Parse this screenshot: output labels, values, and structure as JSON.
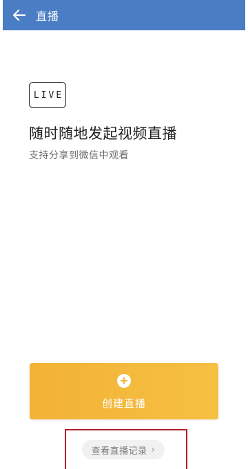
{
  "header": {
    "back_icon": "arrow-left-icon",
    "title": "直播"
  },
  "hero": {
    "badge": "LIVE",
    "headline": "随时随地发起视频直播",
    "subtitle": "支持分享到微信中观看"
  },
  "create_button": {
    "icon": "plus-circle-icon",
    "label": "创建直播"
  },
  "records_button": {
    "label": "查看直播记录",
    "chevron": "›"
  },
  "colors": {
    "header_bg": "#4a7dc4",
    "create_btn": "#f4b83c",
    "highlight_frame": "#b01f2a"
  }
}
